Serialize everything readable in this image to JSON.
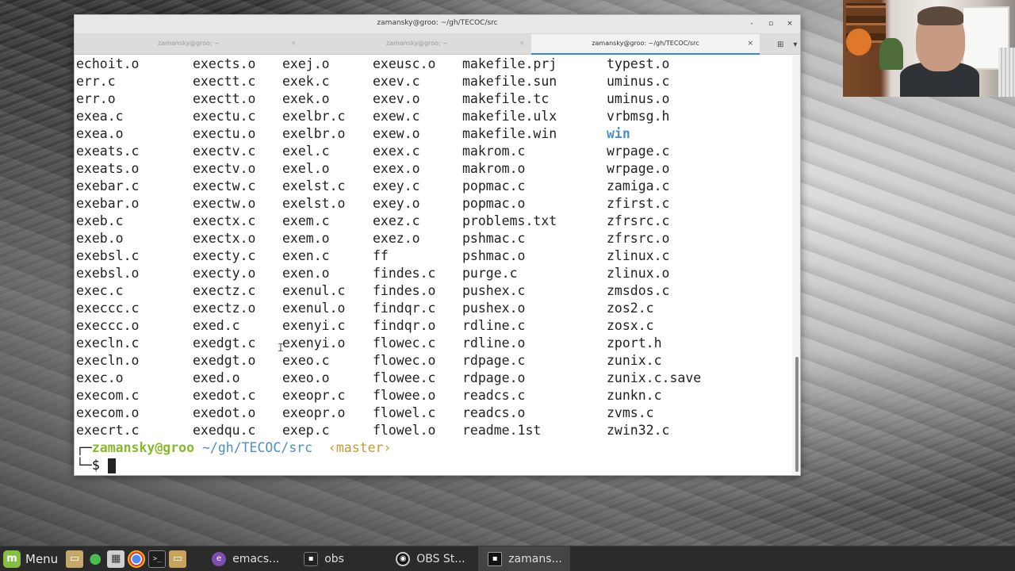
{
  "window": {
    "title": "zamansky@groo: ~/gh/TECOC/src",
    "controls": {
      "minimize": "-",
      "maximize": "▫",
      "close": "×"
    }
  },
  "tabs": [
    {
      "label": "zamansky@groo: ~",
      "close": "×"
    },
    {
      "label": "zamansky@groo: ~",
      "close": "×"
    },
    {
      "label": "zamansky@groo: ~/gh/TECOC/src",
      "close": "×"
    }
  ],
  "tab_tools": {
    "new_tab_icon": "⊞",
    "menu_icon": "▾"
  },
  "terminal": {
    "rows": [
      [
        "echoit.o",
        "exects.o",
        "exej.o",
        "exeusc.o",
        "makefile.prj",
        "typest.o"
      ],
      [
        "err.c",
        "exectt.c",
        "exek.c",
        "exev.c",
        "makefile.sun",
        "uminus.c"
      ],
      [
        "err.o",
        "exectt.o",
        "exek.o",
        "exev.o",
        "makefile.tc",
        "uminus.o"
      ],
      [
        "exea.c",
        "exectu.c",
        "exelbr.c",
        "exew.c",
        "makefile.ulx",
        "vrbmsg.h"
      ],
      [
        "exea.o",
        "exectu.o",
        "exelbr.o",
        "exew.o",
        "makefile.win",
        "win"
      ],
      [
        "exeats.c",
        "exectv.c",
        "exel.c",
        "exex.c",
        "makrom.c",
        "wrpage.c"
      ],
      [
        "exeats.o",
        "exectv.o",
        "exel.o",
        "exex.o",
        "makrom.o",
        "wrpage.o"
      ],
      [
        "exebar.c",
        "exectw.c",
        "exelst.c",
        "exey.c",
        "popmac.c",
        "zamiga.c"
      ],
      [
        "exebar.o",
        "exectw.o",
        "exelst.o",
        "exey.o",
        "popmac.o",
        "zfirst.c"
      ],
      [
        "exeb.c",
        "exectx.c",
        "exem.c",
        "exez.c",
        "problems.txt",
        "zfrsrc.c"
      ],
      [
        "exeb.o",
        "exectx.o",
        "exem.o",
        "exez.o",
        "pshmac.c",
        "zfrsrc.o"
      ],
      [
        "exebsl.c",
        "execty.c",
        "exen.c",
        "ff",
        "pshmac.o",
        "zlinux.c"
      ],
      [
        "exebsl.o",
        "execty.o",
        "exen.o",
        "findes.c",
        "purge.c",
        "zlinux.o"
      ],
      [
        "exec.c",
        "exectz.c",
        "exenul.c",
        "findes.o",
        "pushex.c",
        "zmsdos.c"
      ],
      [
        "execcc.c",
        "exectz.o",
        "exenul.o",
        "findqr.c",
        "pushex.o",
        "zos2.c"
      ],
      [
        "execcc.o",
        "exed.c",
        "exenyi.c",
        "findqr.o",
        "rdline.c",
        "zosx.c"
      ],
      [
        "execln.c",
        "exedgt.c",
        "exenyi.o",
        "flowec.c",
        "rdline.o",
        "zport.h"
      ],
      [
        "execln.o",
        "exedgt.o",
        "exeo.c",
        "flowec.o",
        "rdpage.c",
        "zunix.c"
      ],
      [
        "exec.o",
        "exed.o",
        "exeo.o",
        "flowee.c",
        "rdpage.o",
        "zunix.c.save"
      ],
      [
        "execom.c",
        "exedot.c",
        "exeopr.c",
        "flowee.o",
        "readcs.c",
        "zunkn.c"
      ],
      [
        "execom.o",
        "exedot.o",
        "exeopr.o",
        "flowel.c",
        "readcs.o",
        "zvms.c"
      ],
      [
        "execrt.c",
        "exedqu.c",
        "exep.c",
        "flowel.o",
        "readme.1st",
        "zwin32.c"
      ]
    ],
    "directories": [
      "win"
    ],
    "prompt": {
      "corner": "┌─",
      "user_host": "zamansky@groo",
      "path": "~/gh/TECOC/src",
      "branch": "‹master›",
      "bottom_corner": "└─",
      "symbol": "$"
    },
    "colors": {
      "user": "#89b82a",
      "path": "#4a90c8",
      "branch": "#c49a32",
      "directory": "#4a90c8"
    }
  },
  "taskbar": {
    "menu_label": "Menu",
    "launchers": [
      "folder-icon",
      "vpn-icon",
      "calculator-icon",
      "chrome-icon",
      "terminal-icon",
      "files-icon"
    ],
    "tasks": [
      {
        "label": "emacs...",
        "icon": "emacs-icon"
      },
      {
        "label": "obs",
        "icon": "obs-icon"
      },
      {
        "label": "OBS St...",
        "icon": "obs-studio-icon"
      },
      {
        "label": "zamans...",
        "icon": "terminal-icon"
      }
    ]
  }
}
